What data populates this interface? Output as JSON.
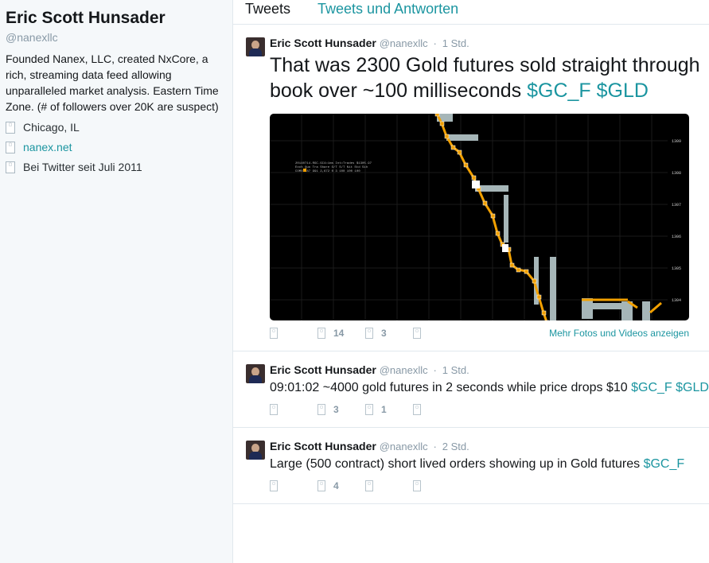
{
  "profile": {
    "name": "Eric Scott Hunsader",
    "handle": "@nanexllc",
    "bio": "Founded Nanex, LLC, created NxCore, a rich, streaming data feed allowing unparalleled market analysis. Eastern Time Zone. (# of followers over 20K are suspect)",
    "location": "Chicago, IL",
    "website": "nanex.net",
    "joined": "Bei Twitter seit Juli 2011",
    "location_icon": "location-icon",
    "website_icon": "link-icon",
    "joined_icon": "calendar-icon"
  },
  "tabs": [
    {
      "label": "Tweets",
      "active": true
    },
    {
      "label": "Tweets und Antworten",
      "active": false
    }
  ],
  "tweets": [
    {
      "name": "Eric Scott Hunsader",
      "handle": "@nanexllc",
      "time": "1 Std.",
      "text_plain": "That was 2300 Gold futures sold straight through book over ~100 milliseconds ",
      "links": "$GC_F $GLD",
      "replies": "",
      "retweets": "14",
      "favorites": "3",
      "more_media": "Mehr Fotos und Videos anzeigen",
      "media": {
        "header_lines": [
          "20140714-RGC.GC4=1ms Int=Trades $1305.97",
          "Exch Quo Tra Share O/T S/T Nit Std Sih",
          "COMX 187 991 2,672 0 3 100 100 100"
        ],
        "y_ticks": [
          "1309",
          "1308",
          "1307",
          "1306",
          "1305",
          "1304"
        ]
      }
    },
    {
      "name": "Eric Scott Hunsader",
      "handle": "@nanexllc",
      "time": "1 Std.",
      "text_plain": "09:01:02 ~4000 gold futures in 2 seconds while price drops $10 ",
      "links": "$GC_F $GLD",
      "replies": "",
      "retweets": "3",
      "favorites": "1"
    },
    {
      "name": "Eric Scott Hunsader",
      "handle": "@nanexllc",
      "time": "2 Std.",
      "text_plain": "Large (500 contract) short lived orders showing up in Gold futures ",
      "links": "$GC_F",
      "replies": "",
      "retweets": "4",
      "favorites": ""
    }
  ],
  "colors": {
    "link": "#1b95a0",
    "muted": "#8899a6",
    "text": "#14171a",
    "chart_bg": "#000000",
    "trade": "#f2a000",
    "quote": "#a6b6b8"
  }
}
